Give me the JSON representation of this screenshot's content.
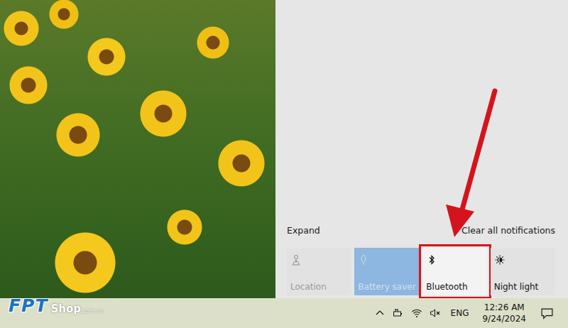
{
  "action_center": {
    "expand_label": "Expand",
    "clear_label": "Clear all notifications",
    "tiles": [
      {
        "label": "Location",
        "kind": "location",
        "on": false,
        "disabled": true,
        "highlighted": false
      },
      {
        "label": "Battery saver",
        "kind": "battery-saver",
        "on": true,
        "disabled": true,
        "highlighted": false
      },
      {
        "label": "Bluetooth",
        "kind": "bluetooth",
        "on": false,
        "disabled": false,
        "highlighted": true
      },
      {
        "label": "Night light",
        "kind": "night-light",
        "on": false,
        "disabled": false,
        "highlighted": false
      }
    ]
  },
  "taskbar": {
    "volume_muted": true,
    "language": "ENG",
    "clock": {
      "time": "12:26 AM",
      "date": "9/24/2024"
    }
  },
  "watermark": {
    "brand": "FPT",
    "shop": "Shop",
    "domain": ".com.vn"
  }
}
